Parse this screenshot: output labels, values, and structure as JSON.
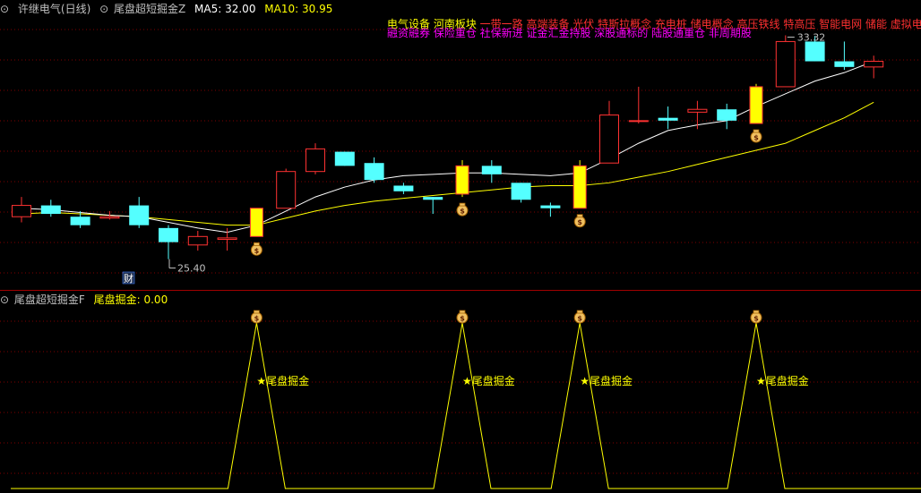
{
  "main_header": {
    "circle": "⊙",
    "stock": "许继电气(日线)",
    "indicator": "尾盘超短掘金Z",
    "ma5_label": "MA5: 32.00",
    "ma10_label": "MA10: 30.95"
  },
  "sub_header": {
    "circle": "⊙",
    "indicator": "尾盘超短掘金F",
    "value_label": "尾盘掘金: 0.00"
  },
  "concept_tags_line1_yellow": "电气设备  河南板块",
  "concept_tags_line1_red": "一带一路 高端装备 光伏 特斯拉概念 充电桩 储电概念 高压铁线 特高压 智能电网 储能 虚拟电",
  "concept_tags_line2": "融资融券 保险重仓 社保新进 证金汇金持股 深股通标的 陆股通重仓 非周期股",
  "annotations": {
    "high_price": "33.32",
    "low_price": "25.40",
    "finance_marker": "财",
    "signal_label": "★尾盘掘金",
    "money_bag_icon": "money-bag-icon"
  },
  "colors": {
    "up": "#ff3232",
    "down": "#54ffff",
    "signal": "#ffff00",
    "ma5": "#ffffff",
    "ma10": "#ffff00",
    "tag_yellow": "#ffff00",
    "tag_red": "#ff3030",
    "tag_magenta": "#ff00ff",
    "grid": "#800000"
  },
  "chart_data": [
    {
      "type": "candlestick",
      "title": "许继电气(日线)",
      "ylim": [
        24.5,
        34.0
      ],
      "candles": [
        {
          "o": 27.3,
          "h": 27.6,
          "l": 26.7,
          "c": 26.9,
          "dir": "up"
        },
        {
          "o": 27.3,
          "h": 27.5,
          "l": 26.9,
          "c": 27.0,
          "dir": "down"
        },
        {
          "o": 26.9,
          "h": 27.1,
          "l": 26.5,
          "c": 26.6,
          "dir": "down"
        },
        {
          "o": 26.9,
          "h": 27.1,
          "l": 26.8,
          "c": 26.85,
          "dir": "up"
        },
        {
          "o": 27.3,
          "h": 27.6,
          "l": 26.5,
          "c": 26.6,
          "dir": "down"
        },
        {
          "o": 26.5,
          "h": 26.6,
          "l": 25.4,
          "c": 26.0,
          "dir": "down"
        },
        {
          "o": 25.9,
          "h": 26.4,
          "l": 25.7,
          "c": 26.2,
          "dir": "up"
        },
        {
          "o": 26.1,
          "h": 26.5,
          "l": 25.7,
          "c": 26.15,
          "dir": "up"
        },
        {
          "o": 26.2,
          "h": 27.2,
          "l": 26.2,
          "c": 27.2,
          "dir": "signal"
        },
        {
          "o": 27.2,
          "h": 28.6,
          "l": 27.2,
          "c": 28.5,
          "dir": "up"
        },
        {
          "o": 28.5,
          "h": 29.5,
          "l": 28.4,
          "c": 29.3,
          "dir": "up"
        },
        {
          "o": 29.2,
          "h": 29.2,
          "l": 28.7,
          "c": 28.7,
          "dir": "down"
        },
        {
          "o": 28.8,
          "h": 29.0,
          "l": 28.1,
          "c": 28.2,
          "dir": "down"
        },
        {
          "o": 28.0,
          "h": 28.1,
          "l": 27.7,
          "c": 27.8,
          "dir": "down"
        },
        {
          "o": 27.6,
          "h": 27.6,
          "l": 27.0,
          "c": 27.5,
          "dir": "down"
        },
        {
          "o": 27.7,
          "h": 28.9,
          "l": 27.6,
          "c": 28.7,
          "dir": "signal"
        },
        {
          "o": 28.7,
          "h": 28.9,
          "l": 28.1,
          "c": 28.4,
          "dir": "down"
        },
        {
          "o": 28.1,
          "h": 28.1,
          "l": 27.4,
          "c": 27.5,
          "dir": "down"
        },
        {
          "o": 27.3,
          "h": 27.4,
          "l": 26.9,
          "c": 27.2,
          "dir": "down"
        },
        {
          "o": 27.2,
          "h": 28.9,
          "l": 27.2,
          "c": 28.7,
          "dir": "signal"
        },
        {
          "o": 28.8,
          "h": 31.0,
          "l": 28.8,
          "c": 30.5,
          "dir": "up"
        },
        {
          "o": 30.3,
          "h": 31.5,
          "l": 30.2,
          "c": 30.3,
          "dir": "up"
        },
        {
          "o": 30.4,
          "h": 30.8,
          "l": 30.0,
          "c": 30.3,
          "dir": "down"
        },
        {
          "o": 30.6,
          "h": 31.0,
          "l": 30.0,
          "c": 30.7,
          "dir": "up"
        },
        {
          "o": 30.7,
          "h": 30.9,
          "l": 30.0,
          "c": 30.3,
          "dir": "down"
        },
        {
          "o": 30.2,
          "h": 31.6,
          "l": 30.2,
          "c": 31.5,
          "dir": "signal"
        },
        {
          "o": 31.5,
          "h": 33.32,
          "l": 31.5,
          "c": 33.1,
          "dir": "up"
        },
        {
          "o": 33.1,
          "h": 33.3,
          "l": 32.4,
          "c": 32.4,
          "dir": "down"
        },
        {
          "o": 32.4,
          "h": 33.1,
          "l": 32.1,
          "c": 32.2,
          "dir": "down"
        },
        {
          "o": 32.2,
          "h": 32.6,
          "l": 31.8,
          "c": 32.4,
          "dir": "up"
        }
      ],
      "ma5": [
        27.2,
        27.15,
        27.05,
        26.95,
        26.9,
        26.7,
        26.5,
        26.35,
        26.6,
        27.1,
        27.6,
        27.95,
        28.2,
        28.35,
        28.4,
        28.45,
        28.45,
        28.4,
        28.35,
        28.45,
        28.95,
        29.5,
        29.95,
        30.15,
        30.3,
        30.8,
        31.25,
        31.7,
        32.0,
        32.4
      ],
      "ma10": [
        27.0,
        27.05,
        27.0,
        26.95,
        26.9,
        26.8,
        26.7,
        26.6,
        26.6,
        26.85,
        27.1,
        27.3,
        27.45,
        27.55,
        27.65,
        27.75,
        27.85,
        27.95,
        28.0,
        28.0,
        28.1,
        28.3,
        28.5,
        28.75,
        29.0,
        29.25,
        29.5,
        29.95,
        30.4,
        30.95
      ],
      "signal_bars": [
        8,
        15,
        19,
        25
      ]
    },
    {
      "type": "line",
      "title": "尾盘超短掘金F",
      "series": [
        {
          "name": "尾盘掘金",
          "peaks_at_bars": [
            8,
            15,
            19,
            25
          ],
          "peak_value": 1,
          "base_value": 0
        }
      ]
    }
  ]
}
